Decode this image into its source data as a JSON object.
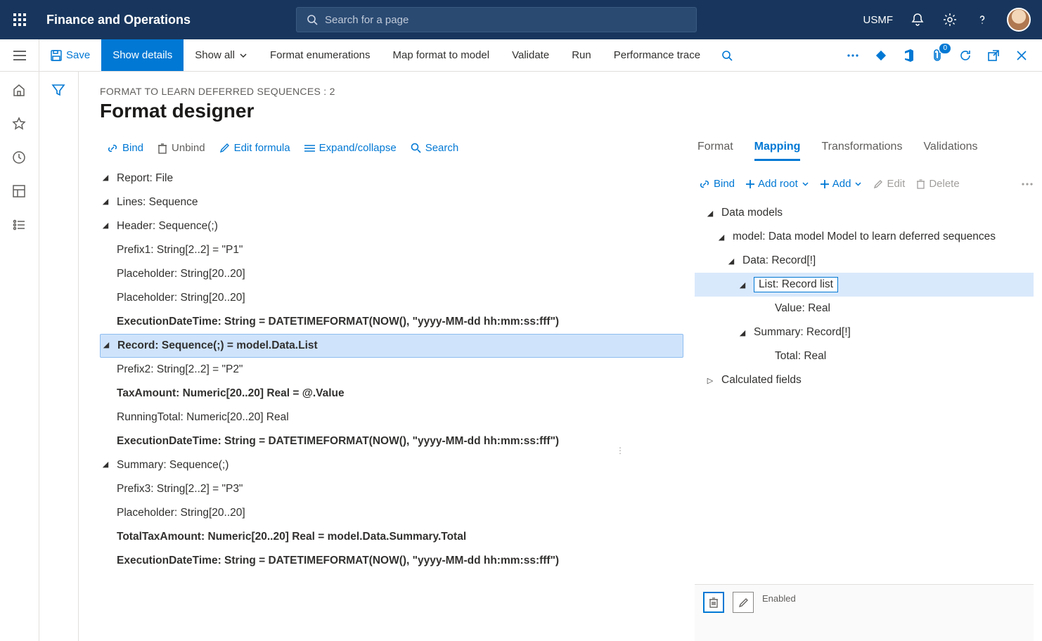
{
  "header": {
    "app_title": "Finance and Operations",
    "search_placeholder": "Search for a page",
    "environment": "USMF"
  },
  "actionbar": {
    "save": "Save",
    "show_details": "Show details",
    "show_all": "Show all",
    "format_enum": "Format enumerations",
    "map_format": "Map format to model",
    "validate": "Validate",
    "run": "Run",
    "perf_trace": "Performance trace",
    "badge_count": "0"
  },
  "page": {
    "breadcrumb": "FORMAT TO LEARN DEFERRED SEQUENCES : 2",
    "title": "Format designer"
  },
  "left_toolbar": {
    "bind": "Bind",
    "unbind": "Unbind",
    "edit_formula": "Edit formula",
    "expand_collapse": "Expand/collapse",
    "search": "Search"
  },
  "format_tree": [
    {
      "level": 0,
      "caret": true,
      "bold": false,
      "selected": false,
      "label": "Report: File"
    },
    {
      "level": 1,
      "caret": true,
      "bold": false,
      "selected": false,
      "label": "Lines: Sequence"
    },
    {
      "level": 2,
      "caret": true,
      "bold": false,
      "selected": false,
      "label": "Header: Sequence(;)"
    },
    {
      "level": 3,
      "caret": false,
      "bold": false,
      "selected": false,
      "label": "Prefix1: String[2..2] = \"P1\""
    },
    {
      "level": 3,
      "caret": false,
      "bold": false,
      "selected": false,
      "label": "Placeholder: String[20..20]"
    },
    {
      "level": 3,
      "caret": false,
      "bold": false,
      "selected": false,
      "label": "Placeholder: String[20..20]"
    },
    {
      "level": 3,
      "caret": false,
      "bold": true,
      "selected": false,
      "label": "ExecutionDateTime: String = DATETIMEFORMAT(NOW(), \"yyyy-MM-dd hh:mm:ss:fff\")"
    },
    {
      "level": 2,
      "caret": true,
      "bold": true,
      "selected": true,
      "label": "Record: Sequence(;) = model.Data.List"
    },
    {
      "level": 3,
      "caret": false,
      "bold": false,
      "selected": false,
      "label": "Prefix2: String[2..2] = \"P2\""
    },
    {
      "level": 3,
      "caret": false,
      "bold": true,
      "selected": false,
      "label": "TaxAmount: Numeric[20..20] Real = @.Value"
    },
    {
      "level": 3,
      "caret": false,
      "bold": false,
      "selected": false,
      "label": "RunningTotal: Numeric[20..20] Real"
    },
    {
      "level": 3,
      "caret": false,
      "bold": true,
      "selected": false,
      "label": "ExecutionDateTime: String = DATETIMEFORMAT(NOW(), \"yyyy-MM-dd hh:mm:ss:fff\")"
    },
    {
      "level": 2,
      "caret": true,
      "bold": false,
      "selected": false,
      "label": "Summary: Sequence(;)"
    },
    {
      "level": 3,
      "caret": false,
      "bold": false,
      "selected": false,
      "label": "Prefix3: String[2..2] = \"P3\""
    },
    {
      "level": 3,
      "caret": false,
      "bold": false,
      "selected": false,
      "label": "Placeholder: String[20..20]"
    },
    {
      "level": 3,
      "caret": false,
      "bold": true,
      "selected": false,
      "label": "TotalTaxAmount: Numeric[20..20] Real = model.Data.Summary.Total"
    },
    {
      "level": 3,
      "caret": false,
      "bold": true,
      "selected": false,
      "label": "ExecutionDateTime: String = DATETIMEFORMAT(NOW(), \"yyyy-MM-dd hh:mm:ss:fff\")"
    }
  ],
  "right_tabs": {
    "format": "Format",
    "mapping": "Mapping",
    "transformations": "Transformations",
    "validations": "Validations",
    "active": "mapping"
  },
  "right_toolbar": {
    "bind": "Bind",
    "add_root": "Add root",
    "add": "Add",
    "edit": "Edit",
    "delete": "Delete"
  },
  "mapping_tree": [
    {
      "level": 0,
      "caret": "down",
      "bold": false,
      "selected": false,
      "boxed": false,
      "label": "Data models"
    },
    {
      "level": 1,
      "caret": "down",
      "bold": true,
      "selected": false,
      "boxed": false,
      "label": "model: Data model Model to learn deferred sequences"
    },
    {
      "level": 2,
      "caret": "down",
      "bold": false,
      "selected": false,
      "boxed": false,
      "label": "Data: Record[!]"
    },
    {
      "level": 3,
      "caret": "down",
      "bold": false,
      "selected": true,
      "boxed": true,
      "label": "List: Record list"
    },
    {
      "level": 4,
      "caret": "",
      "bold": false,
      "selected": false,
      "boxed": false,
      "label": "Value: Real"
    },
    {
      "level": 3,
      "caret": "down",
      "bold": false,
      "selected": false,
      "boxed": false,
      "label": "Summary: Record[!]"
    },
    {
      "level": 4,
      "caret": "",
      "bold": false,
      "selected": false,
      "boxed": false,
      "label": "Total: Real"
    },
    {
      "level": 0,
      "caret": "right",
      "bold": false,
      "selected": false,
      "boxed": false,
      "label": "Calculated fields"
    }
  ],
  "property": {
    "label": "Enabled"
  }
}
